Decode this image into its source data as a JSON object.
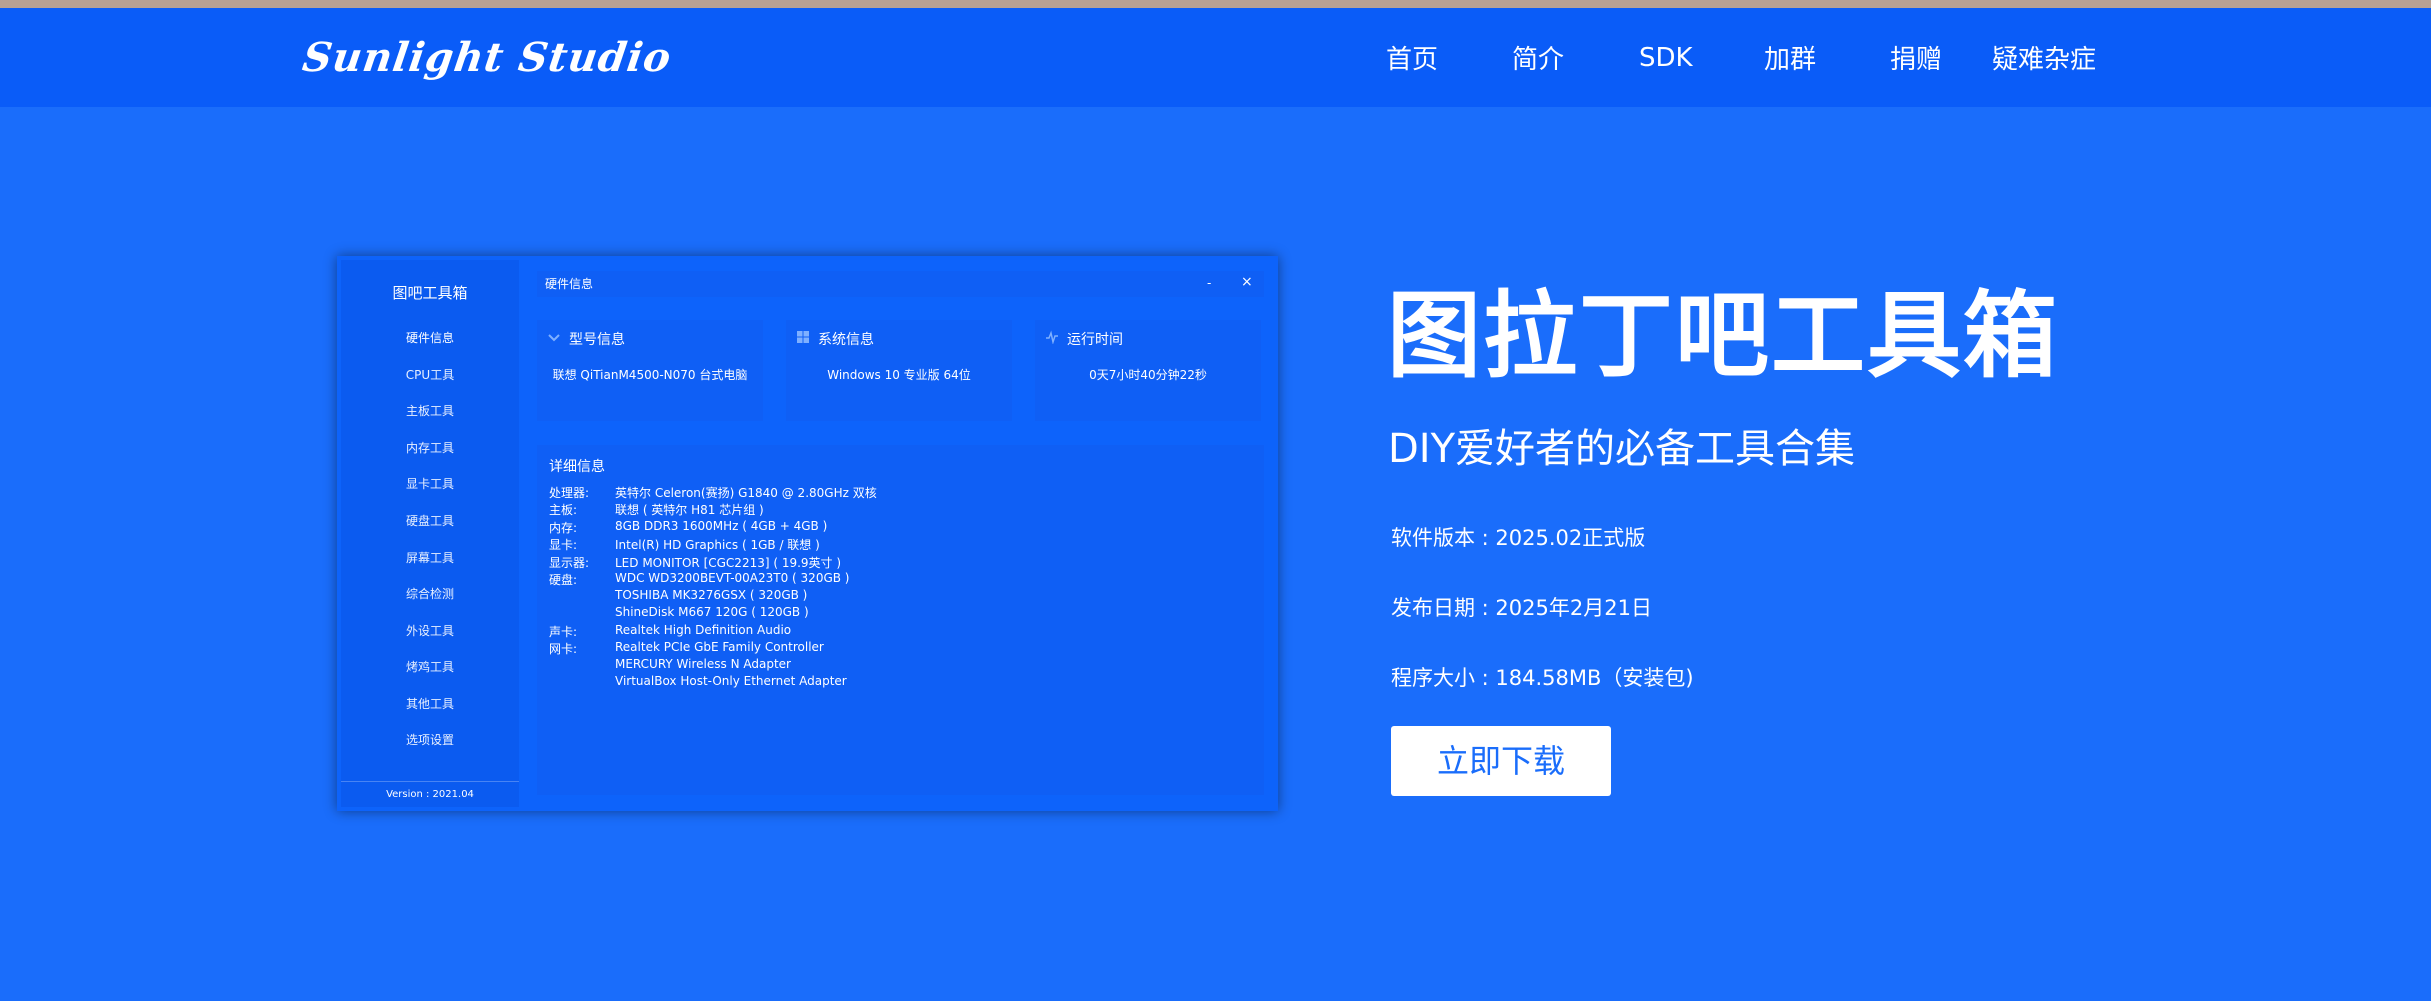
{
  "header": {
    "logo": "Sunlight Studio",
    "nav": [
      "首页",
      "简介",
      "SDK",
      "加群",
      "捐赠",
      "疑难杂症"
    ]
  },
  "app": {
    "title": "图吧工具箱",
    "sidebar": [
      "硬件信息",
      "CPU工具",
      "主板工具",
      "内存工具",
      "显卡工具",
      "硬盘工具",
      "屏幕工具",
      "综合检测",
      "外设工具",
      "烤鸡工具",
      "其他工具",
      "选项设置"
    ],
    "version": "Version : 2021.04",
    "window_title": "硬件信息",
    "window_min": "-",
    "window_close": "×",
    "cards": [
      {
        "title": "型号信息",
        "value": "联想 QiTianM4500-N070 台式电脑"
      },
      {
        "title": "系统信息",
        "value": "Windows 10 专业版 64位"
      },
      {
        "title": "运行时间",
        "value": "0天7小时40分钟22秒"
      }
    ],
    "detail_title": "详细信息",
    "details": [
      {
        "label": "处理器:",
        "value": "英特尔 Celeron(赛扬) G1840 @ 2.80GHz 双核"
      },
      {
        "label": "主板:",
        "value": "联想 ( 英特尔 H81 芯片组 )"
      },
      {
        "label": "内存:",
        "value": "8GB DDR3 1600MHz ( 4GB + 4GB )"
      },
      {
        "label": "显卡:",
        "value": "Intel(R) HD Graphics ( 1GB / 联想 )"
      },
      {
        "label": "显示器:",
        "value": "LED MONITOR [CGC2213] ( 19.9英寸 )"
      },
      {
        "label": "硬盘:",
        "value": "WDC WD3200BEVT-00A23T0 ( 320GB )"
      },
      {
        "label": "",
        "value": "TOSHIBA MK3276GSX ( 320GB )"
      },
      {
        "label": "",
        "value": "ShineDisk M667 120G ( 120GB )"
      },
      {
        "label": "声卡:",
        "value": "Realtek High Definition Audio"
      },
      {
        "label": "网卡:",
        "value": "Realtek PCIe GbE Family Controller"
      },
      {
        "label": "",
        "value": "MERCURY Wireless N Adapter"
      },
      {
        "label": "",
        "value": "VirtualBox Host-Only Ethernet Adapter"
      }
    ]
  },
  "hero": {
    "title": "图拉丁吧工具箱",
    "subtitle": "DIY爱好者的必备工具合集",
    "version": "软件版本 : 2025.02正式版",
    "date": "发布日期 : 2025年2月21日",
    "size": "程序大小 : 184.58MB（安装包)",
    "download": "立即下载"
  },
  "colors": {
    "background": "#1a6dfb",
    "header": "#0a5cf8",
    "panel": "#0f5ff5"
  }
}
